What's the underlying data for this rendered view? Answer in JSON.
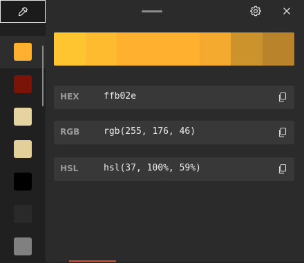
{
  "toolbar": {
    "picker_icon": "eyedropper-icon",
    "drag_handle_icon": "drag-handle-icon",
    "settings_icon": "gear-icon",
    "close_icon": "close-icon"
  },
  "swatches": [
    {
      "color": "#ffb02e",
      "selected": true
    },
    {
      "color": "#7a1408",
      "selected": false
    },
    {
      "color": "#e5d4a1",
      "selected": false
    },
    {
      "color": "#e2cf99",
      "selected": false
    },
    {
      "color": "#000000",
      "selected": false
    },
    {
      "color": "#2a2a2a",
      "selected": false
    },
    {
      "color": "#808080",
      "selected": false
    }
  ],
  "gradient": [
    {
      "color": "#ffc530"
    },
    {
      "color": "#ffbb30"
    },
    {
      "color": "#ffb02e"
    },
    {
      "color": "#f4aa2e"
    },
    {
      "color": "#cc922c"
    },
    {
      "color": "#b8832a"
    }
  ],
  "values": [
    {
      "label": "HEX",
      "value": "ffb02e"
    },
    {
      "label": "RGB",
      "value": "rgb(255, 176, 46)"
    },
    {
      "label": "HSL",
      "value": "hsl(37, 100%, 59%)"
    }
  ]
}
